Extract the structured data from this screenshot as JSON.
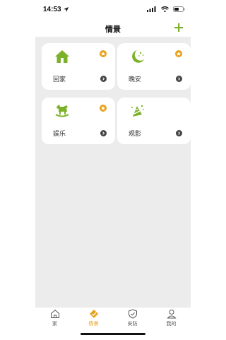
{
  "status_bar": {
    "time": "14:53"
  },
  "header": {
    "title": "情景"
  },
  "scenes": [
    {
      "label": "回家",
      "icon": "home-icon"
    },
    {
      "label": "晚安",
      "icon": "moon-stars-icon"
    },
    {
      "label": "娱乐",
      "icon": "rocking-horse-icon"
    },
    {
      "label": "观影",
      "icon": "party-hat-icon"
    }
  ],
  "tabs": [
    {
      "label": "家",
      "icon": "house-icon",
      "active": false
    },
    {
      "label": "情景",
      "icon": "scene-icon",
      "active": true
    },
    {
      "label": "安防",
      "icon": "shield-icon",
      "active": false
    },
    {
      "label": "我的",
      "icon": "person-icon",
      "active": false
    }
  ],
  "colors": {
    "accent_green": "#7cb22a",
    "accent_orange": "#e8a21a",
    "background": "#ececec"
  }
}
